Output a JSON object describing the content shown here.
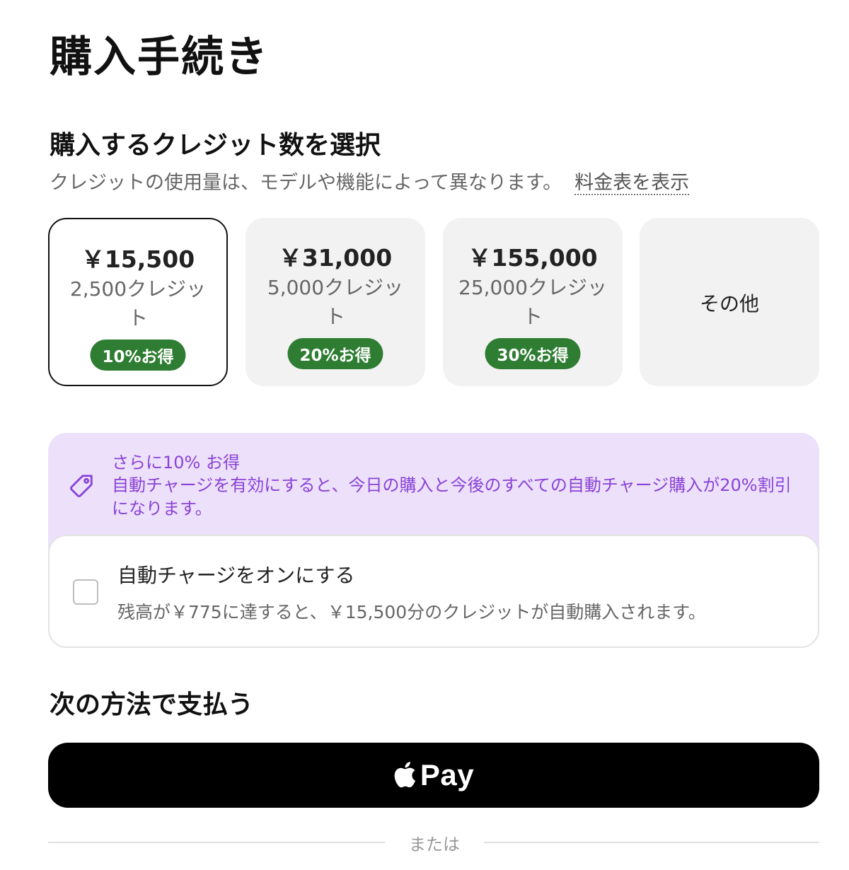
{
  "page_title": "購入手続き",
  "credits_section": {
    "title": "購入するクレジット数を選択",
    "subtitle": "クレジットの使用量は、モデルや機能によって異なります。",
    "pricing_link": "料金表を表示"
  },
  "options": [
    {
      "price": "￥15,500",
      "credits": "2,500クレジット",
      "badge": "10%お得",
      "selected": true
    },
    {
      "price": "￥31,000",
      "credits": "5,000クレジット",
      "badge": "20%お得",
      "selected": false
    },
    {
      "price": "￥155,000",
      "credits": "25,000クレジット",
      "badge": "30%お得",
      "selected": false
    },
    {
      "label": "その他",
      "selected": false
    }
  ],
  "promo": {
    "icon": "tag-icon",
    "title": "さらに10% お得",
    "text": "自動チャージを有効にすると、今日の購入と今後のすべての自動チャージ購入が20%割引になります。"
  },
  "autocharge": {
    "title": "自動チャージをオンにする",
    "description": "残高が￥775に達すると、￥15,500分のクレジットが自動購入されます。",
    "checked": false
  },
  "payment": {
    "title": "次の方法で支払う",
    "apple_pay_label": "Pay",
    "apple_icon": "apple-icon",
    "or_text": "または"
  },
  "colors": {
    "badge_green": "#2e7d32",
    "promo_bg": "#ece0fb",
    "promo_text": "#8a43d6",
    "option_bg": "#f2f2f2"
  }
}
